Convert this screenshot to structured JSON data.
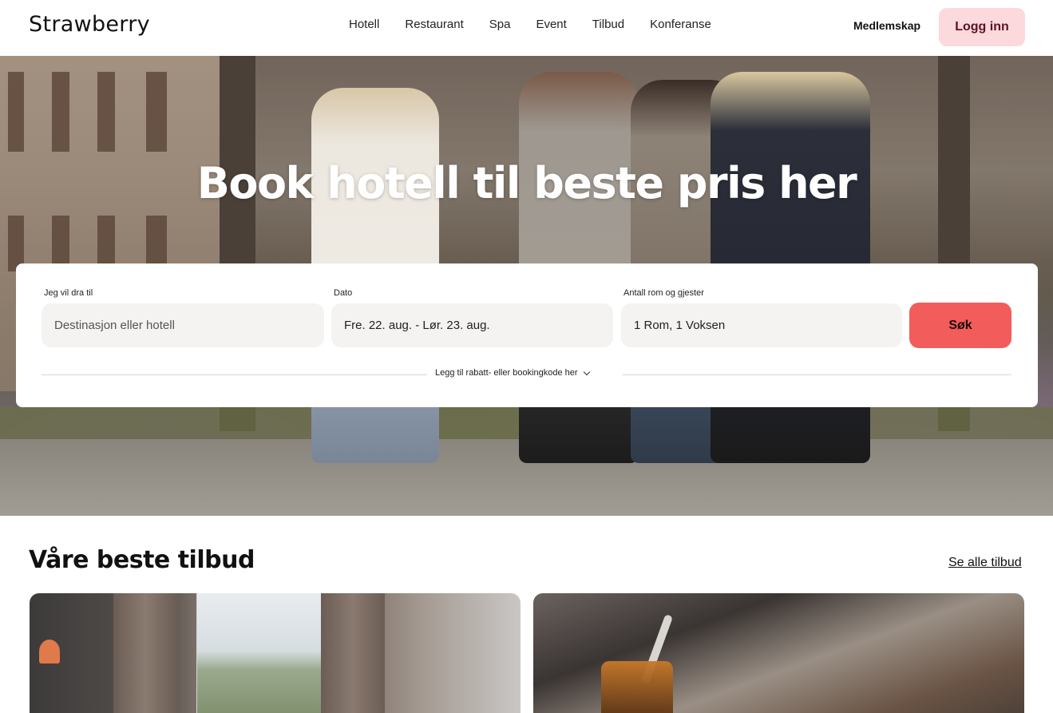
{
  "header": {
    "logo": "Strawberry",
    "nav": [
      "Hotell",
      "Restaurant",
      "Spa",
      "Event",
      "Tilbud",
      "Konferanse"
    ],
    "membership": "Medlemskap",
    "login": "Logg inn"
  },
  "hero": {
    "title": "Book hotell til beste pris her"
  },
  "search": {
    "destination_label": "Jeg vil dra til",
    "destination_placeholder": "Destinasjon eller hotell",
    "date_label": "Dato",
    "date_value": "Fre. 22. aug. - Lør. 23. aug.",
    "guests_label": "Antall rom og gjester",
    "guests_value": "1 Rom, 1 Voksen",
    "search_button": "Søk",
    "promo_code": "Legg til rabatt- eller bookingkode her"
  },
  "offers": {
    "title": "Våre beste tilbud",
    "see_all": "Se alle tilbud"
  },
  "colors": {
    "search_button": "#f25c5a",
    "login_button": "#fcd9dc"
  }
}
